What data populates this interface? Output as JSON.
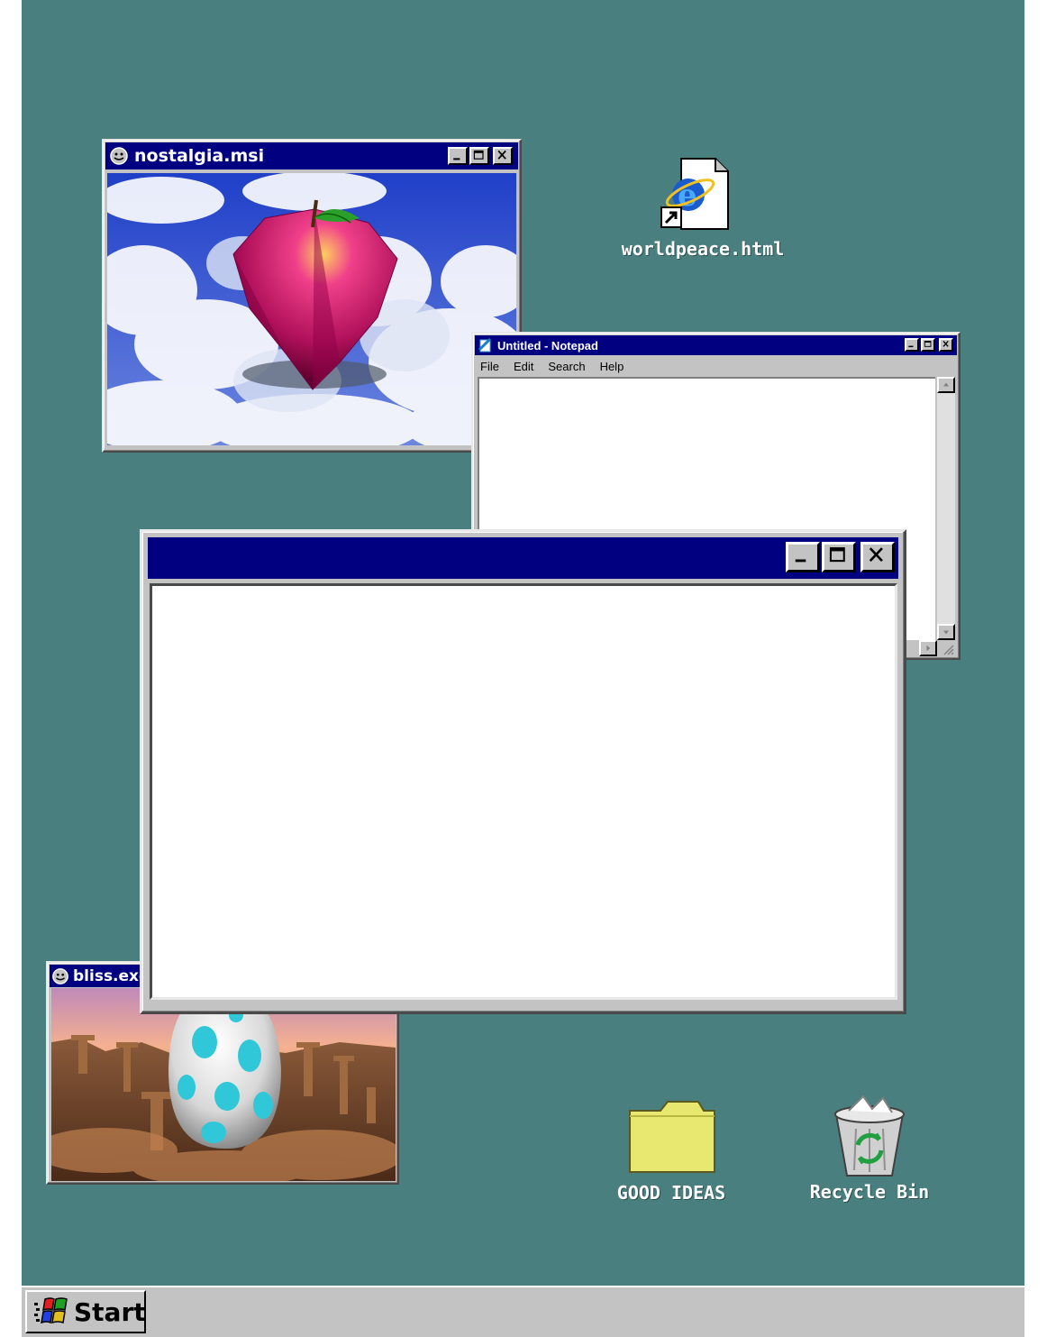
{
  "desktop": {
    "background": "#4a7f7f",
    "icons": [
      {
        "label": "worldpeace.html",
        "icon": "internet-explorer-shortcut-icon"
      },
      {
        "label": "GOOD IDEAS",
        "icon": "folder-icon"
      },
      {
        "label": "Recycle Bin",
        "icon": "recycle-bin-icon"
      }
    ]
  },
  "windows": {
    "nostalgia": {
      "title": "nostalgia.msi",
      "content": "pink apple floating in clouds"
    },
    "notepad": {
      "title": "Untitled - Notepad",
      "menu": [
        "File",
        "Edit",
        "Search",
        "Help"
      ],
      "text": ""
    },
    "blank": {
      "title": ""
    },
    "bliss": {
      "title": "bliss.exe",
      "content": "spotted egg over canyon"
    }
  },
  "taskbar": {
    "start_label": "Start",
    "color": "#c3c3c3"
  },
  "colors": {
    "titlebar": "#000080",
    "window_face": "#c3c3c3"
  }
}
